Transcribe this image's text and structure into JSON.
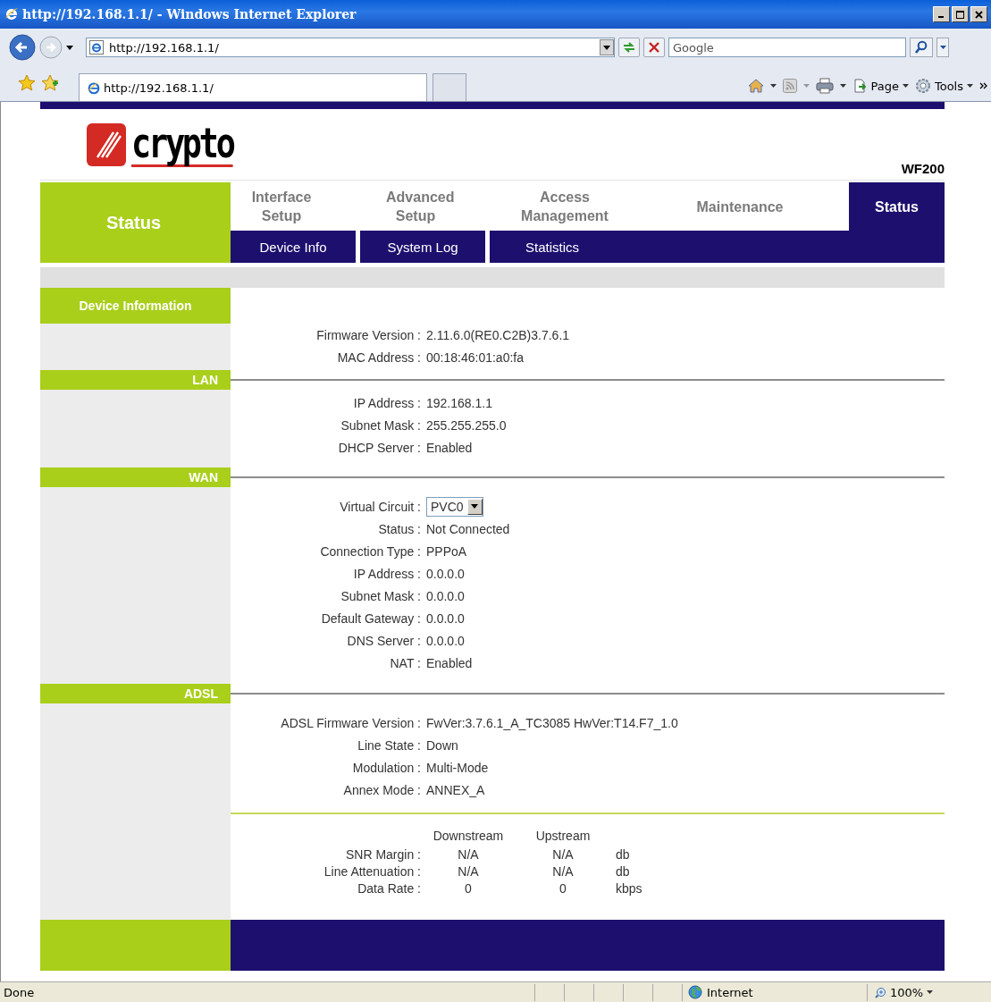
{
  "window": {
    "title": "http://192.168.1.1/ - Windows Internet Explorer"
  },
  "address_bar": {
    "value": "http://192.168.1.1/"
  },
  "search": {
    "placeholder": "Google"
  },
  "tab": {
    "label": "http://192.168.1.1/"
  },
  "command_bar": {
    "items": [
      "Page",
      "Tools"
    ]
  },
  "router": {
    "logo": "crypto",
    "model": "WF200",
    "section_title": "Status",
    "nav": [
      {
        "label": "Interface Setup",
        "selected": false
      },
      {
        "label": "Advanced Setup",
        "selected": false
      },
      {
        "label": "Access Management",
        "selected": false
      },
      {
        "label": "Maintenance",
        "selected": false
      },
      {
        "label": "Status",
        "selected": true
      }
    ],
    "subnav": [
      "Device Info",
      "System Log",
      "Statistics"
    ]
  },
  "sections": [
    {
      "title": "Device Information",
      "kind": "main",
      "rows": [
        {
          "kind": "text",
          "label": "Firmware Version :",
          "value": "2.11.6.0(RE0.C2B)3.7.6.1"
        },
        {
          "kind": "text",
          "label": "MAC Address :",
          "value": "00:18:46:01:a0:fa"
        }
      ]
    },
    {
      "title": "LAN",
      "kind": "group",
      "rows": [
        {
          "kind": "text",
          "label": "IP Address :",
          "value": "192.168.1.1"
        },
        {
          "kind": "text",
          "label": "Subnet Mask :",
          "value": "255.255.255.0"
        },
        {
          "kind": "text",
          "label": "DHCP Server :",
          "value": "Enabled"
        }
      ]
    },
    {
      "title": "WAN",
      "kind": "group",
      "rows": [
        {
          "kind": "select",
          "label": "Virtual Circuit :",
          "value": "PVC0"
        },
        {
          "kind": "text",
          "label": "Status :",
          "value": "Not Connected"
        },
        {
          "kind": "text",
          "label": "Connection Type :",
          "value": "PPPoA"
        },
        {
          "kind": "text",
          "label": "IP Address :",
          "value": "0.0.0.0"
        },
        {
          "kind": "text",
          "label": "Subnet Mask :",
          "value": "0.0.0.0"
        },
        {
          "kind": "text",
          "label": "Default Gateway :",
          "value": "0.0.0.0"
        },
        {
          "kind": "text",
          "label": "DNS Server :",
          "value": "0.0.0.0"
        },
        {
          "kind": "text",
          "label": "NAT :",
          "value": "Enabled"
        }
      ]
    },
    {
      "title": "ADSL",
      "kind": "group",
      "rows": [
        {
          "kind": "text",
          "label": "ADSL Firmware Version :",
          "value": "FwVer:3.7.6.1_A_TC3085 HwVer:T14.F7_1.0"
        },
        {
          "kind": "text",
          "label": "Line State :",
          "value": "Down"
        },
        {
          "kind": "text",
          "label": "Modulation :",
          "value": "Multi-Mode"
        },
        {
          "kind": "text",
          "label": "Annex Mode :",
          "value": "ANNEX_A"
        }
      ],
      "stats": {
        "columns": [
          "Downstream",
          "Upstream"
        ],
        "rows": [
          {
            "label": "SNR Margin :",
            "down": "N/A",
            "up": "N/A",
            "unit": "db"
          },
          {
            "label": "Line Attenuation :",
            "down": "N/A",
            "up": "N/A",
            "unit": "db"
          },
          {
            "label": "Data Rate :",
            "down": "0",
            "up": "0",
            "unit": "kbps"
          }
        ]
      }
    }
  ],
  "status_bar": {
    "text": "Done",
    "zone": "Internet",
    "zoom": "100%"
  }
}
